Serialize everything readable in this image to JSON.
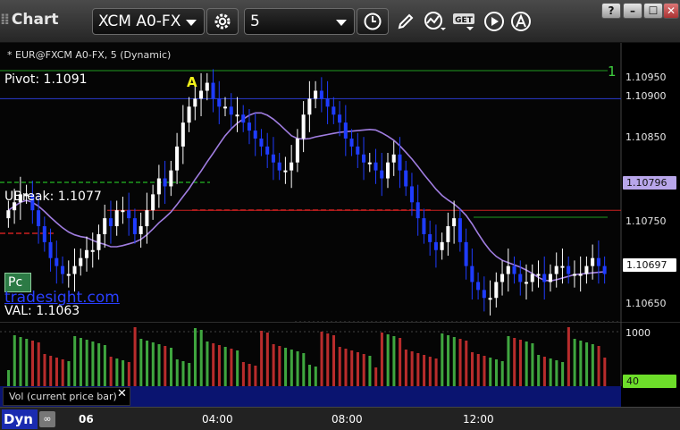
{
  "window": {
    "title": "Chart"
  },
  "toolbar": {
    "symbol": "XCM A0-FX",
    "interval": "5",
    "get_label": "GET"
  },
  "window_controls": {
    "help": "?",
    "minimize": "–",
    "maximize": "☐",
    "close": "✕"
  },
  "chart": {
    "subtitle": "* EUR@FXCM A0-FX, 5 (Dynamic)",
    "pivot_label": "Pivot: 1.1091",
    "ubreak_label": "UBreak: 1.1077",
    "val_label": "VAL: 1.1063",
    "marker_a": "A",
    "marker_1": "1",
    "pc_badge": "Pc",
    "watermark": "tradesight.com",
    "y_ticks": [
      "1.10950",
      "1.10900",
      "1.10850",
      "1.10750",
      "1.10650"
    ],
    "price_tags": {
      "ma": "1.10796",
      "last": "1.10697"
    },
    "vol_ticks": {
      "top": "1000",
      "tag": "40"
    },
    "vol_caption": "Vol (current price bar)",
    "x_ticks": [
      "06",
      "04:00",
      "08:00",
      "12:00"
    ],
    "dyn_label": "Dyn"
  },
  "colors": {
    "bull": "#ffffff",
    "bear": "#1f3cff",
    "ma": "#a07de0",
    "pivot": "#2b3bd0",
    "green_level": "#1f9a1f",
    "red_level": "#cc2020",
    "vol_up": "#3fa63f",
    "vol_down": "#b82c2c",
    "accent": "#66d63a"
  },
  "chart_data": {
    "type": "candlestick",
    "title": "* EUR@FXCM A0-FX, 5 (Dynamic)",
    "ylim": [
      1.1063,
      1.1098
    ],
    "levels": {
      "pivot": 1.1091,
      "ubreak": 1.1077,
      "val": 1.1063
    },
    "closes": [
      1.1077,
      1.1078,
      1.1079,
      1.1079,
      1.1077,
      1.1075,
      1.1073,
      1.1071,
      1.107,
      1.1069,
      1.1069,
      1.107,
      1.1071,
      1.1072,
      1.1072,
      1.1074,
      1.1076,
      1.1075,
      1.1077,
      1.1077,
      1.1076,
      1.1074,
      1.1075,
      1.1077,
      1.1079,
      1.1081,
      1.108,
      1.1082,
      1.1085,
      1.1088,
      1.109,
      1.1091,
      1.1092,
      1.1093,
      1.1091,
      1.109,
      1.109,
      1.1089,
      1.1089,
      1.1088,
      1.1087,
      1.1086,
      1.1085,
      1.1084,
      1.1083,
      1.1082,
      1.1082,
      1.1083,
      1.1086,
      1.1089,
      1.1091,
      1.1092,
      1.1091,
      1.109,
      1.1089,
      1.1088,
      1.1086,
      1.1085,
      1.1084,
      1.1083,
      1.1083,
      1.1082,
      1.1081,
      1.1083,
      1.1084,
      1.1082,
      1.108,
      1.1078,
      1.1076,
      1.1074,
      1.1073,
      1.1072,
      1.1073,
      1.1075,
      1.1076,
      1.1073,
      1.107,
      1.1068,
      1.1067,
      1.1066,
      1.1066,
      1.1068,
      1.1069,
      1.107,
      1.1069,
      1.1068,
      1.1068,
      1.1069,
      1.1069,
      1.1068,
      1.1069,
      1.107,
      1.107,
      1.1069,
      1.1069,
      1.1069,
      1.107,
      1.1071,
      1.107,
      1.1069
    ]
  }
}
